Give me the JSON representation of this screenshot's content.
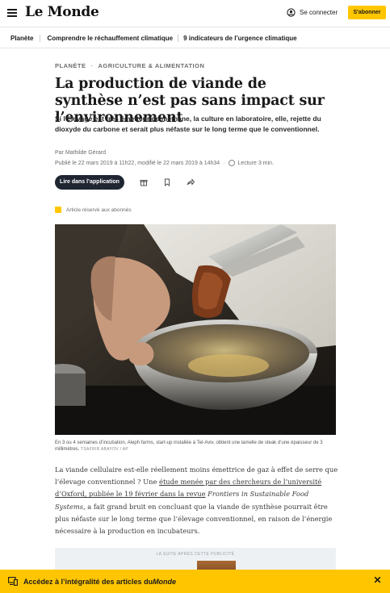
{
  "header": {
    "logo": "Le Monde",
    "login_label": "Se connecter",
    "subscribe_label": "S'abonner"
  },
  "nav": {
    "items": [
      {
        "label": "Planète"
      },
      {
        "label": "Comprendre le réchauffement climatique"
      },
      {
        "label": "9 indicateurs de l’urgence climatique"
      }
    ]
  },
  "article": {
    "breadcrumb": [
      "Planète",
      "Agriculture & alimentation"
    ],
    "breadcrumb_sep": "·",
    "title": "La production de viande de synthèse n’est pas sans impact sur l’environnement",
    "lede": "Si l’élevage est très émetteur de méthane, la culture en laboratoire, elle, rejette du dioxyde du carbone et serait plus néfaste sur le long terme que le conventionnel.",
    "author": "Par Mathilde Gérard",
    "published": "Publié le 22 mars 2019 à 11h22, modifié le 22 mars 2019 à 14h34",
    "meta_sep": "·",
    "reading_time": "Lecture 3 min.",
    "app_button": "Lire dans l’application",
    "reserved_label": "Article réservé aux abonnés",
    "caption": "En 3 ou 4 semaines d’incubation, Aleph farms, start-up installée à Tel-Aviv, obtient une lamelle de steak d’une épaisseur de 3 millimètres.",
    "caption_credit": "TSAFRIR ABAYOV / AP",
    "body_intro": "La viande cellulaire est-elle réellement moins émettrice de gaz à effet de serre que l’élevage conventionnel ? Une ",
    "body_link": "étude menée par des chercheurs de l’université d’Oxford, publiée le 19 février dans la revue",
    "body_journal": "Frontiers in Sustainable Food Systems",
    "body_rest": ", a fait grand bruit en concluant que la viande de synthèse pourrait être plus néfaste sur le long terme que l’élevage conventionnel, en raison de l’énergie nécessaire à la production en incubateurs.",
    "ad_label": "LA SUITE APRÈS CETTE PUBLICITÉ"
  },
  "banner": {
    "text_prefix": "Accédez à l’intégralité des articles du ",
    "text_brand": "Monde",
    "close": "✕"
  },
  "colors": {
    "accent": "#ffc600",
    "dark_button": "#1f2632"
  },
  "icons": [
    "menu-icon",
    "user-icon",
    "clock-icon",
    "gift-icon",
    "bookmark-icon",
    "share-icon",
    "subscriber-badge-icon",
    "devices-icon",
    "close-icon"
  ]
}
